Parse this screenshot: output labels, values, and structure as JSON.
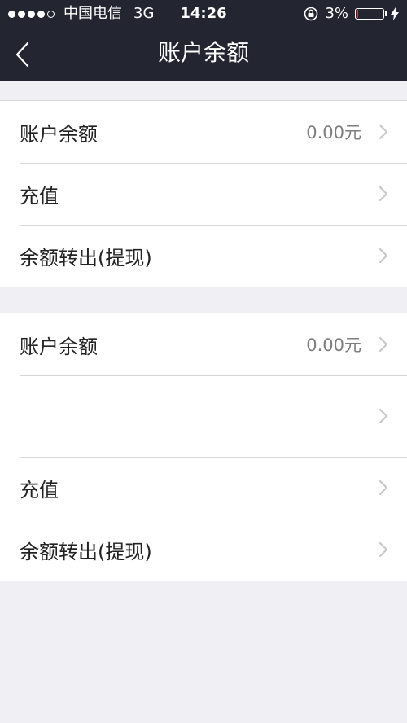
{
  "status_bar": {
    "carrier": "中国电信",
    "network": "3G",
    "time": "14:26",
    "battery_text": "3%",
    "battery_level_percent": 3,
    "battery_color": "#e23c3c",
    "icons": [
      "signal-dots-icon",
      "orientation-lock-icon",
      "battery-icon",
      "charging-bolt-icon"
    ]
  },
  "nav": {
    "title": "账户余额",
    "back_icon": "chevron-left-icon"
  },
  "group1": {
    "rows": [
      {
        "label": "账户余额",
        "value": "0.00元"
      },
      {
        "label": "充值"
      },
      {
        "label": "余额转出(提现)"
      }
    ]
  },
  "group2": {
    "rows": [
      {
        "label": "账户余额",
        "value": "0.00元"
      },
      {
        "label": ""
      },
      {
        "label": "充值"
      },
      {
        "label": "余额转出(提现)"
      }
    ]
  },
  "colors": {
    "header_bg": "#232531",
    "page_bg": "#efeff4",
    "separator": "#d6d6da",
    "chevron": "#c7c7cc"
  }
}
